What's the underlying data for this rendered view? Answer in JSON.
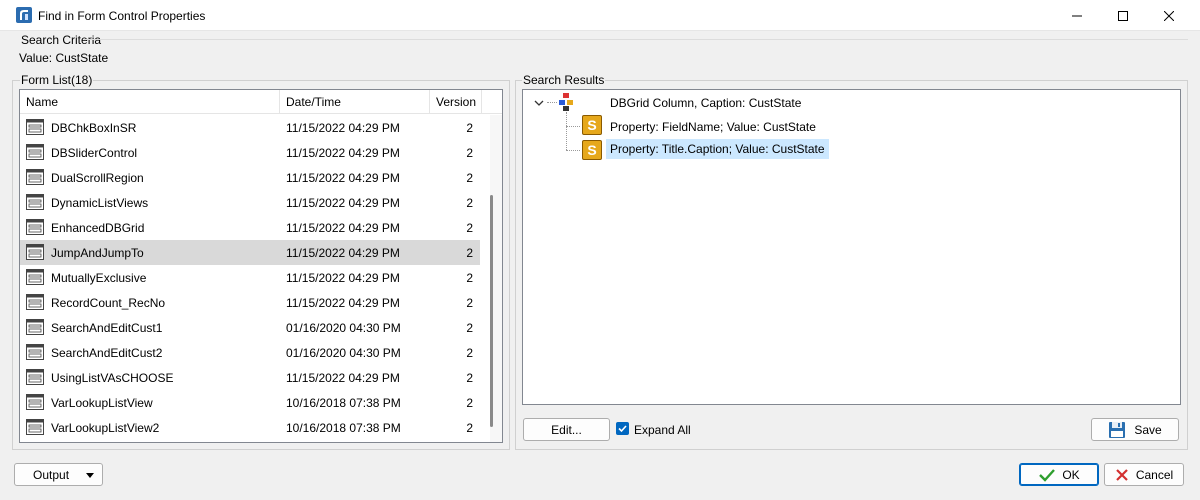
{
  "window": {
    "title": "Find in Form Control Properties",
    "icon": "app-icon",
    "controls": [
      "minimize-icon",
      "maximize-icon",
      "close-icon"
    ]
  },
  "search_criteria": {
    "legend": "Search Criteria",
    "value": "Value: CustState"
  },
  "form_list": {
    "label": "Form List(18)",
    "columns": [
      "Name",
      "Date/Time",
      "Version"
    ],
    "selected_index": 5,
    "rows": [
      {
        "name": "DBChkBoxInSR",
        "date": "11/15/2022 04:29 PM",
        "version": "2"
      },
      {
        "name": "DBSliderControl",
        "date": "11/15/2022 04:29 PM",
        "version": "2"
      },
      {
        "name": "DualScrollRegion",
        "date": "11/15/2022 04:29 PM",
        "version": "2"
      },
      {
        "name": "DynamicListViews",
        "date": "11/15/2022 04:29 PM",
        "version": "2"
      },
      {
        "name": "EnhancedDBGrid",
        "date": "11/15/2022 04:29 PM",
        "version": "2"
      },
      {
        "name": "JumpAndJumpTo",
        "date": "11/15/2022 04:29 PM",
        "version": "2"
      },
      {
        "name": "MutuallyExclusive",
        "date": "11/15/2022 04:29 PM",
        "version": "2"
      },
      {
        "name": "RecordCount_RecNo",
        "date": "11/15/2022 04:29 PM",
        "version": "2"
      },
      {
        "name": "SearchAndEditCust1",
        "date": "01/16/2020 04:30 PM",
        "version": "2"
      },
      {
        "name": "SearchAndEditCust2",
        "date": "01/16/2020 04:30 PM",
        "version": "2"
      },
      {
        "name": "UsingListVAsCHOOSE",
        "date": "11/15/2022 04:29 PM",
        "version": "2"
      },
      {
        "name": "VarLookupListView",
        "date": "10/16/2018 07:38 PM",
        "version": "2"
      },
      {
        "name": "VarLookupListView2",
        "date": "10/16/2018 07:38 PM",
        "version": "2"
      }
    ]
  },
  "search_results": {
    "label": "Search Results",
    "root": {
      "text": "DBGrid Column, Caption: CustState",
      "icon": "dbgrid-column-icon",
      "expanded": true
    },
    "children": [
      {
        "text": "Property: FieldName; Value: CustState",
        "icon": "s-property-icon",
        "glyph": "S"
      },
      {
        "text": "Property: Title.Caption; Value: CustState",
        "icon": "s-property-icon",
        "glyph": "S",
        "selected": true
      }
    ]
  },
  "buttons": {
    "edit": "Edit...",
    "expand_all": "Expand All",
    "expand_all_checked": true,
    "save": "Save",
    "output": "Output",
    "ok": "OK",
    "cancel": "Cancel"
  },
  "colors": {
    "selection_row": "#d9d9d9",
    "tree_selection": "#cce8ff",
    "accent": "#0067c0",
    "property_icon": "#e6a81c",
    "ok_check": "#2e9e2e",
    "cancel_x": "#d32f2f"
  }
}
